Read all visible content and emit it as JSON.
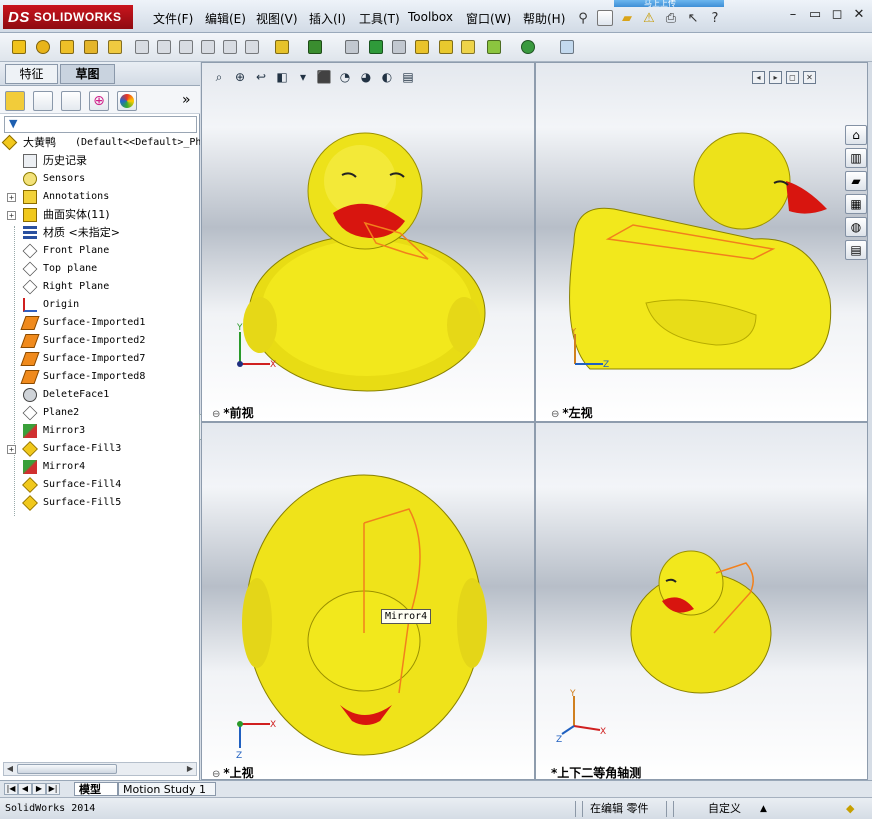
{
  "app": {
    "brand": "SOLIDWORKS",
    "brand_prefix": "DS",
    "cloud_tab": "马上上传"
  },
  "menu": [
    "文件(F)",
    "编辑(E)",
    "视图(V)",
    "插入(I)",
    "工具(T)",
    "Toolbox",
    "窗口(W)",
    "帮助(H)"
  ],
  "window_controls": [
    "restore-icon",
    "minimize-icon",
    "maximize-icon",
    "close-icon"
  ],
  "left_pane": {
    "tabs": [
      "特征",
      "草图"
    ],
    "collapse_glyph": "»",
    "tree_root": {
      "name": "大黄鸭",
      "config": "(Default<<Default>_Ph"
    },
    "tree_items": [
      {
        "label": "历史记录",
        "icon": "history-icon",
        "expandable": false
      },
      {
        "label": "Sensors",
        "icon": "sensor-icon",
        "expandable": false
      },
      {
        "label": "Annotations",
        "icon": "annotations-icon",
        "expandable": true
      },
      {
        "label": "曲面实体(11)",
        "icon": "surface-bodies-icon",
        "expandable": true
      },
      {
        "label": "材质 <未指定>",
        "icon": "material-icon",
        "expandable": false
      },
      {
        "label": "Front Plane",
        "icon": "plane-icon",
        "expandable": false
      },
      {
        "label": "Top plane",
        "icon": "plane-icon",
        "expandable": false
      },
      {
        "label": "Right Plane",
        "icon": "plane-icon",
        "expandable": false
      },
      {
        "label": "Origin",
        "icon": "origin-icon",
        "expandable": false
      },
      {
        "label": "Surface-Imported1",
        "icon": "surface-imported-icon",
        "expandable": false
      },
      {
        "label": "Surface-Imported2",
        "icon": "surface-imported-icon",
        "expandable": false
      },
      {
        "label": "Surface-Imported7",
        "icon": "surface-imported-icon",
        "expandable": false
      },
      {
        "label": "Surface-Imported8",
        "icon": "surface-imported-icon",
        "expandable": false
      },
      {
        "label": "DeleteFace1",
        "icon": "delete-face-icon",
        "expandable": false
      },
      {
        "label": "Plane2",
        "icon": "plane-icon",
        "expandable": false
      },
      {
        "label": "Mirror3",
        "icon": "mirror-icon",
        "expandable": false
      },
      {
        "label": "Surface-Fill3",
        "icon": "surface-fill-icon",
        "expandable": true
      },
      {
        "label": "Mirror4",
        "icon": "mirror-icon",
        "expandable": false
      },
      {
        "label": "Surface-Fill4",
        "icon": "surface-fill-icon",
        "expandable": false
      },
      {
        "label": "Surface-Fill5",
        "icon": "surface-fill-icon",
        "expandable": false
      }
    ]
  },
  "viewports": {
    "front": {
      "label": "*前视"
    },
    "left": {
      "label": "*左视"
    },
    "top": {
      "label": "*上视"
    },
    "iso": {
      "label": "*上下二等角轴测"
    }
  },
  "axes": {
    "x": "X",
    "y": "Y",
    "z": "Z"
  },
  "tooltip": "Mirror4",
  "bottom_tabs": [
    "模型",
    "Motion Study 1"
  ],
  "status": {
    "version": "SolidWorks 2014",
    "mode": "在编辑 零件",
    "units": "自定义"
  },
  "colors": {
    "duck": "#f2e81c",
    "beak": "#e01a12",
    "sketch": "#f2801c",
    "accent": "#3a78c2"
  }
}
